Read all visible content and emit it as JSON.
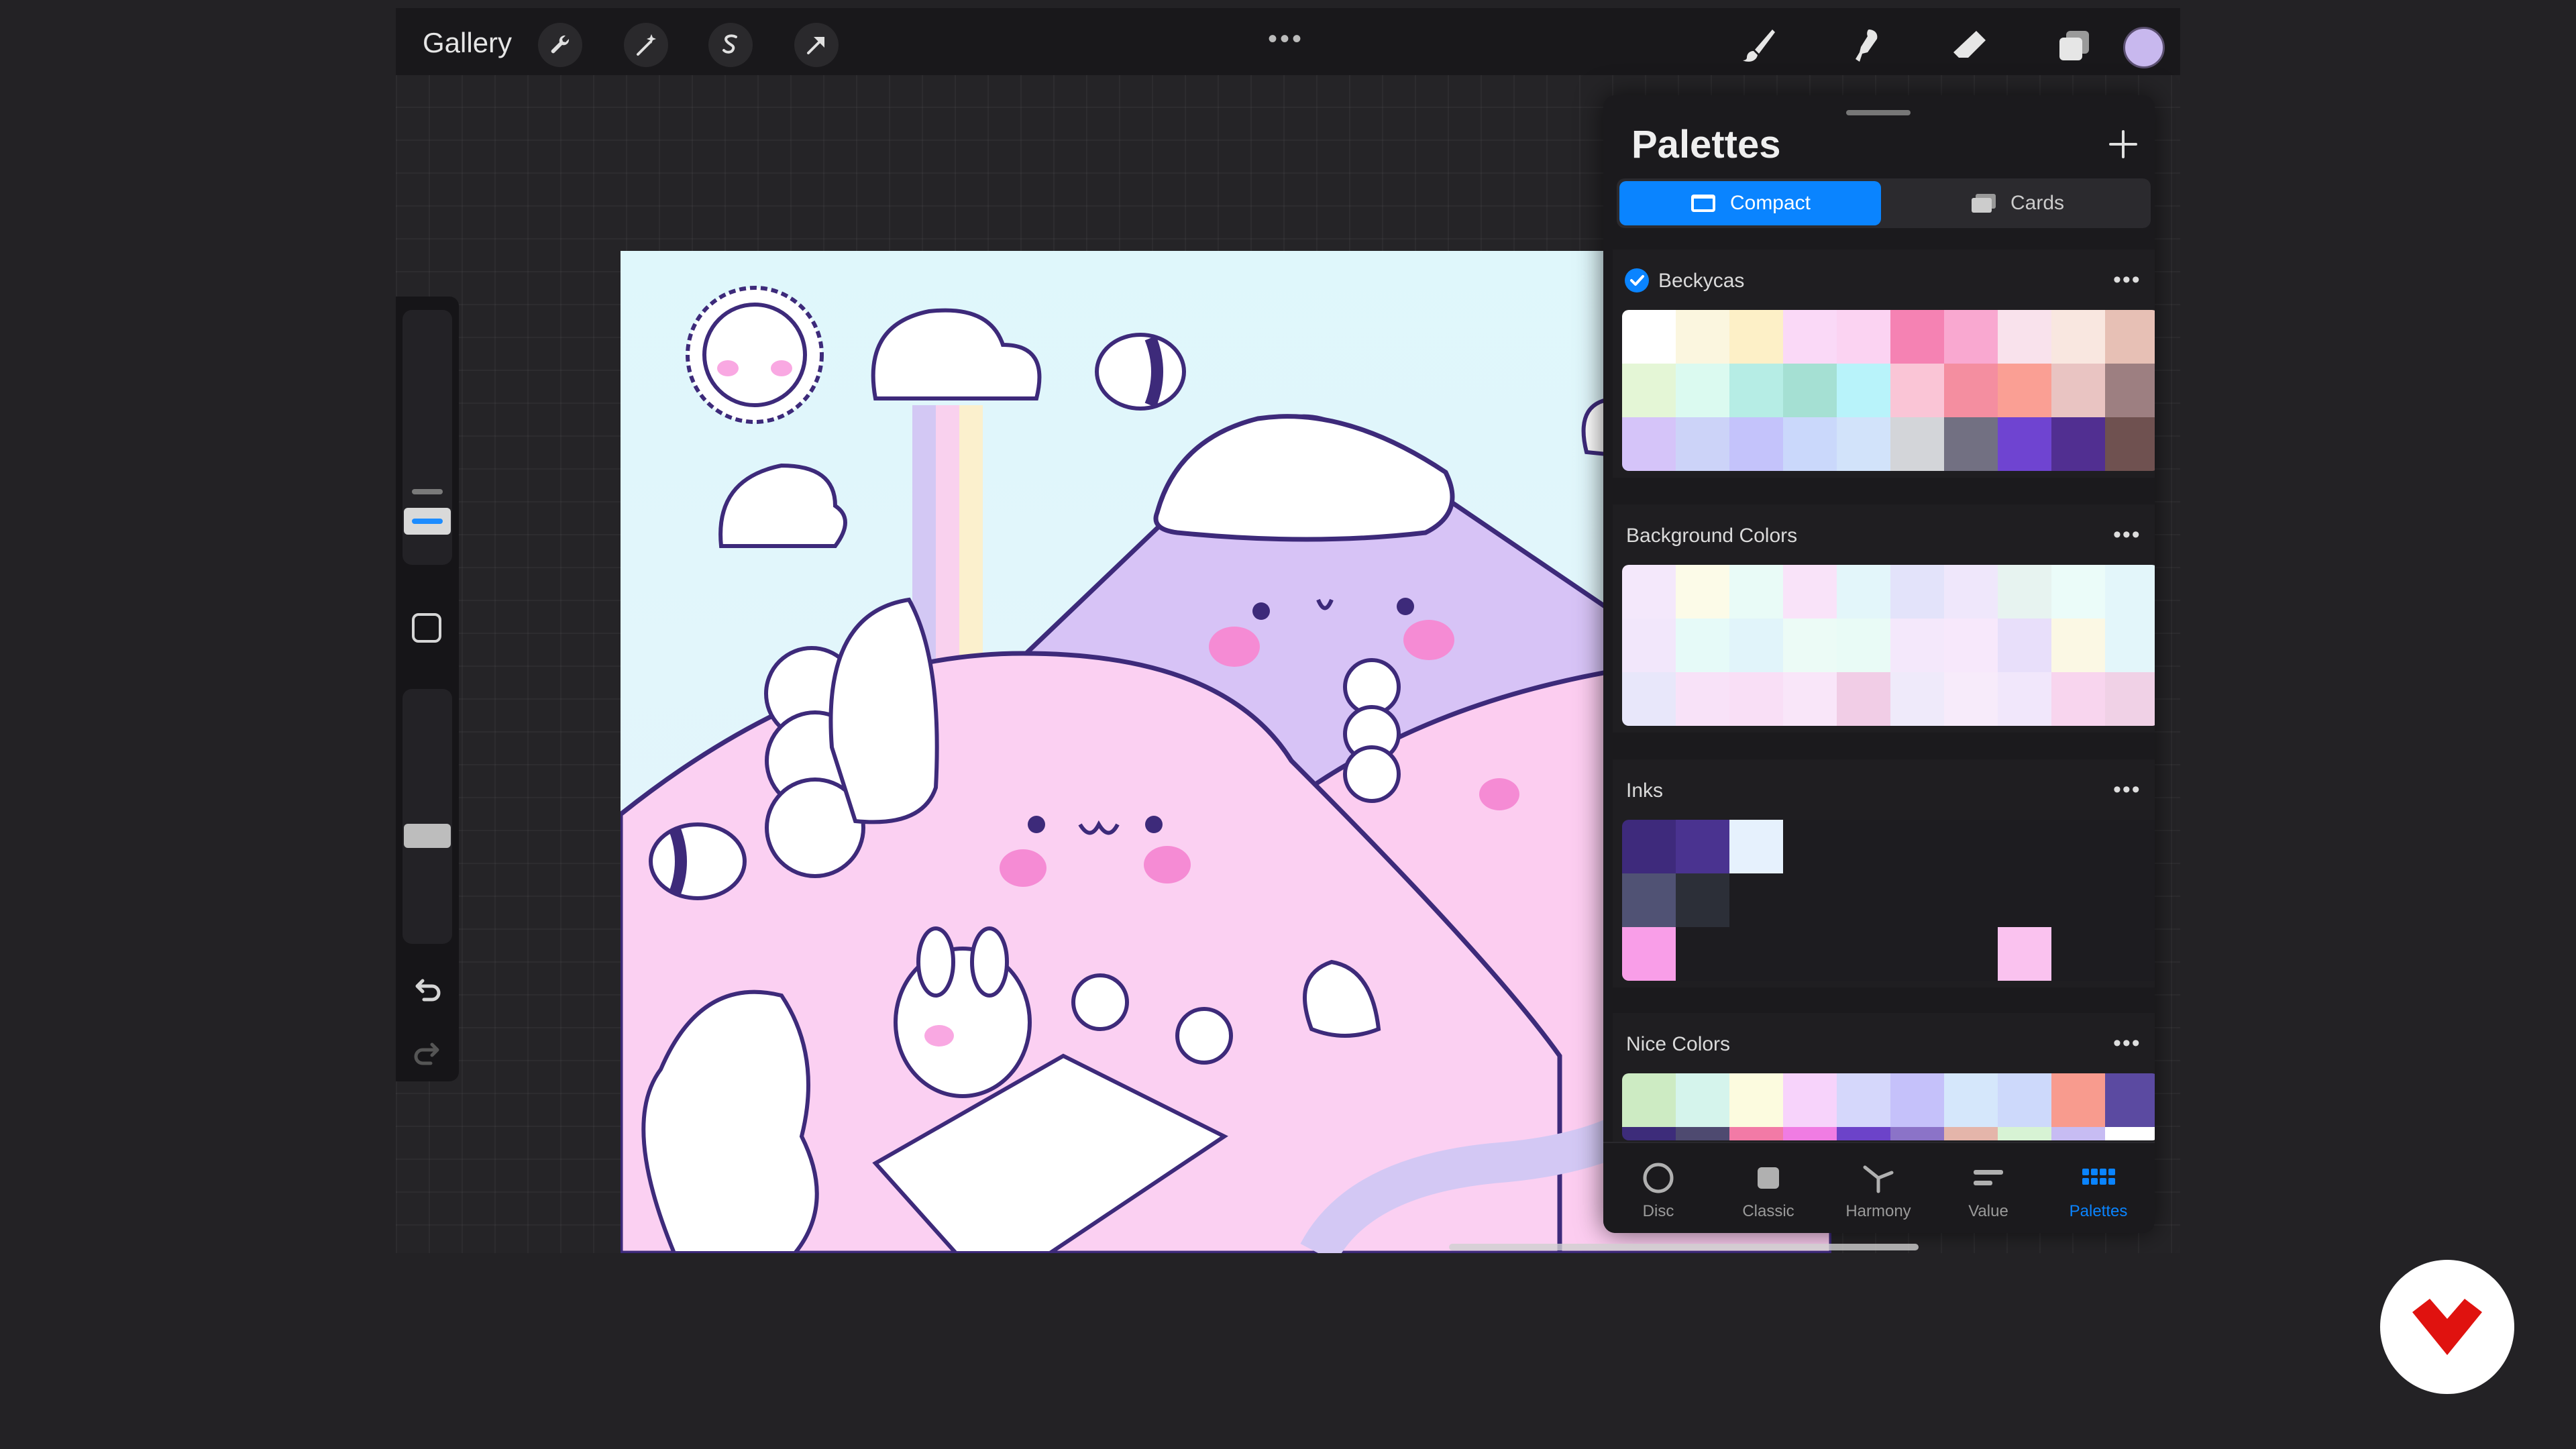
{
  "toolbar": {
    "gallery_label": "Gallery",
    "left_tools": [
      "wrench-icon",
      "magic-wand-icon",
      "selection-icon",
      "transform-arrow-icon"
    ],
    "more_label": "•••",
    "right_tools": [
      "brush-icon",
      "smudge-icon",
      "eraser-icon",
      "layers-icon"
    ],
    "current_color": "#c8b8ee"
  },
  "palettes_panel": {
    "title": "Palettes",
    "add_label": "+",
    "view_modes": [
      {
        "label": "Compact",
        "active": true
      },
      {
        "label": "Cards",
        "active": false
      }
    ],
    "palettes": [
      {
        "name": "Beckycas",
        "default": true,
        "more": "•••",
        "swatches": [
          "#ffffff",
          "#fbf6df",
          "#fdf0c7",
          "#fad9f7",
          "#fbd3f2",
          "#f582b3",
          "#f9a8d0",
          "#f9e2ec",
          "#f9e7e0",
          "#e7c0b5",
          "#e4f6d6",
          "#dbfaf0",
          "#b6ede5",
          "#a5e0d3",
          "#b8f3fa",
          "#fac5d6",
          "#f48ea0",
          "#fa9f94",
          "#e9c4c2",
          "#9d7f81",
          "#d5c4f9",
          "#ccd3f8",
          "#c4c3fb",
          "#cad8fb",
          "#d2e3fa",
          "#d3d5d9",
          "#727082",
          "#6f44d1",
          "#512f91",
          "#6f5150"
        ]
      },
      {
        "name": "Background Colors",
        "default": false,
        "more": "•••",
        "swatches": [
          "#f4e8fb",
          "#fcfbe8",
          "#e9fbf7",
          "#f9e3f9",
          "#e3f6fa",
          "#e3e3fa",
          "#efe7fb",
          "#e7f3f0",
          "#ebfcf9",
          "#e3f6fa",
          "#f2e7fb",
          "#e6faf8",
          "#e1f4fa",
          "#ecfbf6",
          "#e9fbf6",
          "#f4e8fb",
          "#f7e8fb",
          "#e8dffa",
          "#fbf8e4",
          "#e3f6fa",
          "#e8e7fa",
          "#f8e2f8",
          "#f9dff6",
          "#f9e6f9",
          "#f1cde6",
          "#efeafa",
          "#f7ebfa",
          "#f1e7fb",
          "#f8d5ee",
          "#f0d1e6"
        ]
      },
      {
        "name": "Inks",
        "default": false,
        "more": "•••",
        "swatches": [
          "#3e2a7c",
          "#4a3390",
          "#e6f1fd",
          "#1d1c20",
          "#1d1c20",
          "#1d1c20",
          "#1d1c20",
          "#1d1c20",
          "#1d1c20",
          "#1d1c20",
          "#505274",
          "#2c2f38",
          "#1d1c20",
          "#1d1c20",
          "#1d1c20",
          "#1d1c20",
          "#1d1c20",
          "#1d1c20",
          "#1d1c20",
          "#1d1c20",
          "#f99ee8",
          "#1d1c20",
          "#1d1c20",
          "#1d1c20",
          "#1d1c20",
          "#1d1c20",
          "#1d1c20",
          "#fac2ef",
          "#1d1c20",
          "#1d1c20"
        ]
      },
      {
        "name": "Nice Colors",
        "default": false,
        "more": "•••",
        "swatches": [
          "#cdebc3",
          "#d5f4ec",
          "#fcfbdf",
          "#f7d3fb",
          "#d5d7fb",
          "#c5c1fa",
          "#d5e7fb",
          "#cdd9fb",
          "#f89b8e",
          "#5b4aa1",
          "#3d2c7a",
          "#4e4a70",
          "#f27aa6",
          "#f07ce3",
          "#6c43c9",
          "#8b73c8",
          "#e4b5aa",
          "#d7f3d4",
          "#c7bcf3",
          "#ffffff"
        ]
      }
    ],
    "bottom_nav": [
      {
        "label": "Disc",
        "icon": "disc-icon",
        "active": false
      },
      {
        "label": "Classic",
        "icon": "classic-square-icon",
        "active": false
      },
      {
        "label": "Harmony",
        "icon": "harmony-icon",
        "active": false
      },
      {
        "label": "Value",
        "icon": "value-sliders-icon",
        "active": false
      },
      {
        "label": "Palettes",
        "icon": "palettes-grid-icon",
        "active": true
      }
    ]
  }
}
